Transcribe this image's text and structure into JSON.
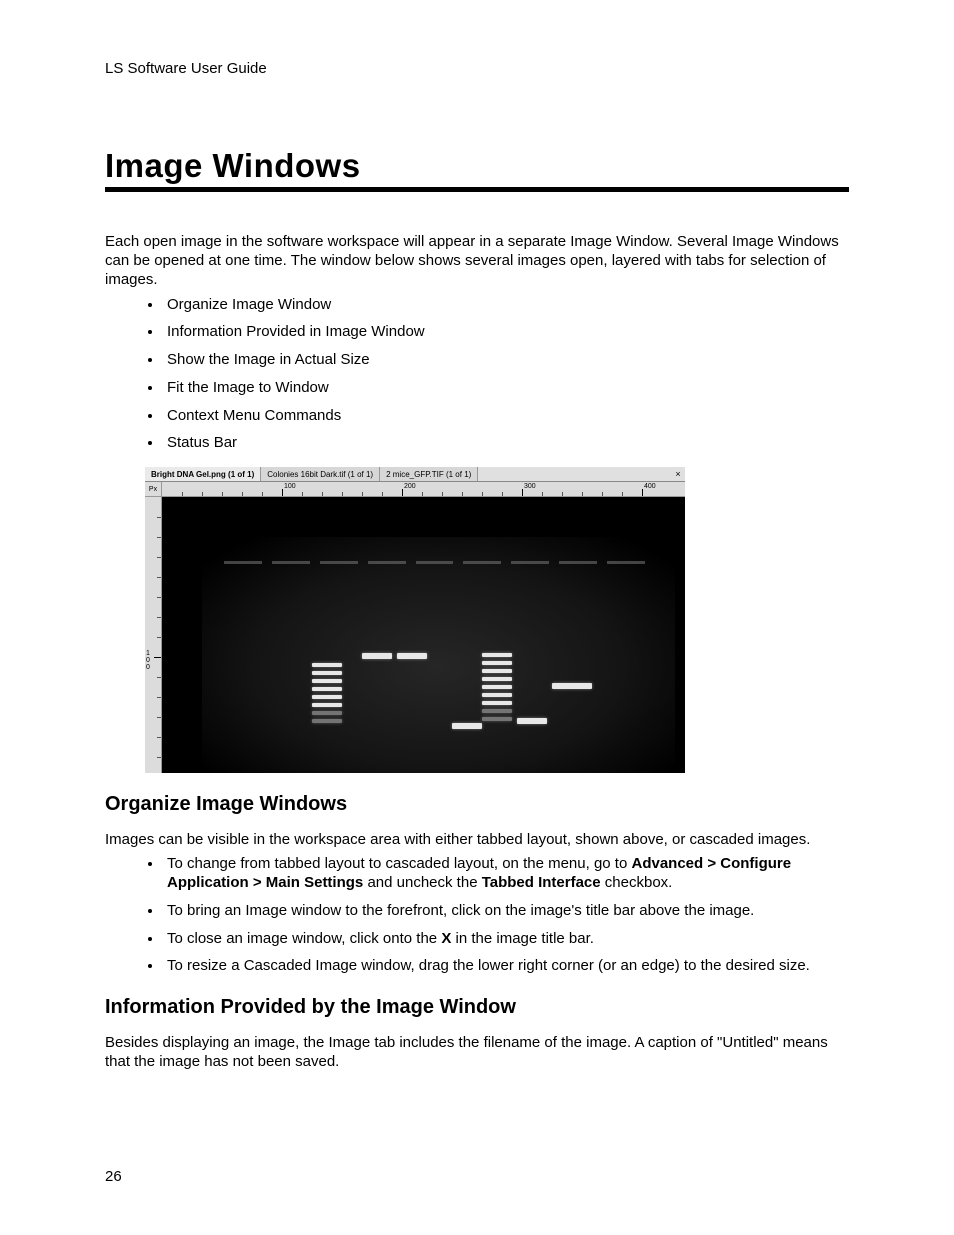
{
  "header": "LS Software User Guide",
  "title": "Image Windows",
  "intro": "Each open image in the software workspace will appear in a separate Image Window. Several Image Windows can be opened at one time. The window below shows several images open, layered with tabs for selection of images.",
  "top_bullets": [
    "Organize Image Window",
    "Information Provided in Image Window",
    "Show the Image in Actual Size",
    "Fit the Image to Window",
    "Context Menu Commands",
    "Status Bar"
  ],
  "screenshot": {
    "corner_label": "Px",
    "tabs": [
      {
        "label": "Bright DNA Gel.png (1 of 1)",
        "active": true
      },
      {
        "label": "Colonies 16bit Dark.tif (1 of 1)",
        "active": false
      },
      {
        "label": "2 mice_GFP.TIF (1 of 1)",
        "active": false
      }
    ],
    "close_glyph": "×",
    "ruler_h_ticks": [
      "100",
      "200",
      "300",
      "400"
    ],
    "ruler_v_major_label_100": "1\n0\n0"
  },
  "section1": {
    "heading": "Organize Image Windows",
    "para": "Images can be visible in the workspace area with either tabbed layout, shown above, or cascaded images.",
    "bullets": [
      {
        "pre": "To change from tabbed layout to cascaded layout, on the menu, go to ",
        "b1": "Advanced > Configure Application  > Main Settings",
        "mid": " and uncheck the ",
        "b2": "Tabbed Interface",
        "post": " checkbox."
      },
      {
        "plain": "To bring an Image window to the forefront,  click on the image's title bar above the image."
      },
      {
        "pre": "To close an image window, click onto the ",
        "b1": "X",
        "post": " in the image title bar."
      },
      {
        "plain": "To resize a Cascaded Image window, drag the lower right corner (or an edge) to the desired size."
      }
    ]
  },
  "section2": {
    "heading": "Information Provided by the Image Window",
    "para": "Besides displaying an image, the Image tab includes the filename of the image. A caption of \"Untitled\" means that the image has not been saved."
  },
  "page_number": "26"
}
